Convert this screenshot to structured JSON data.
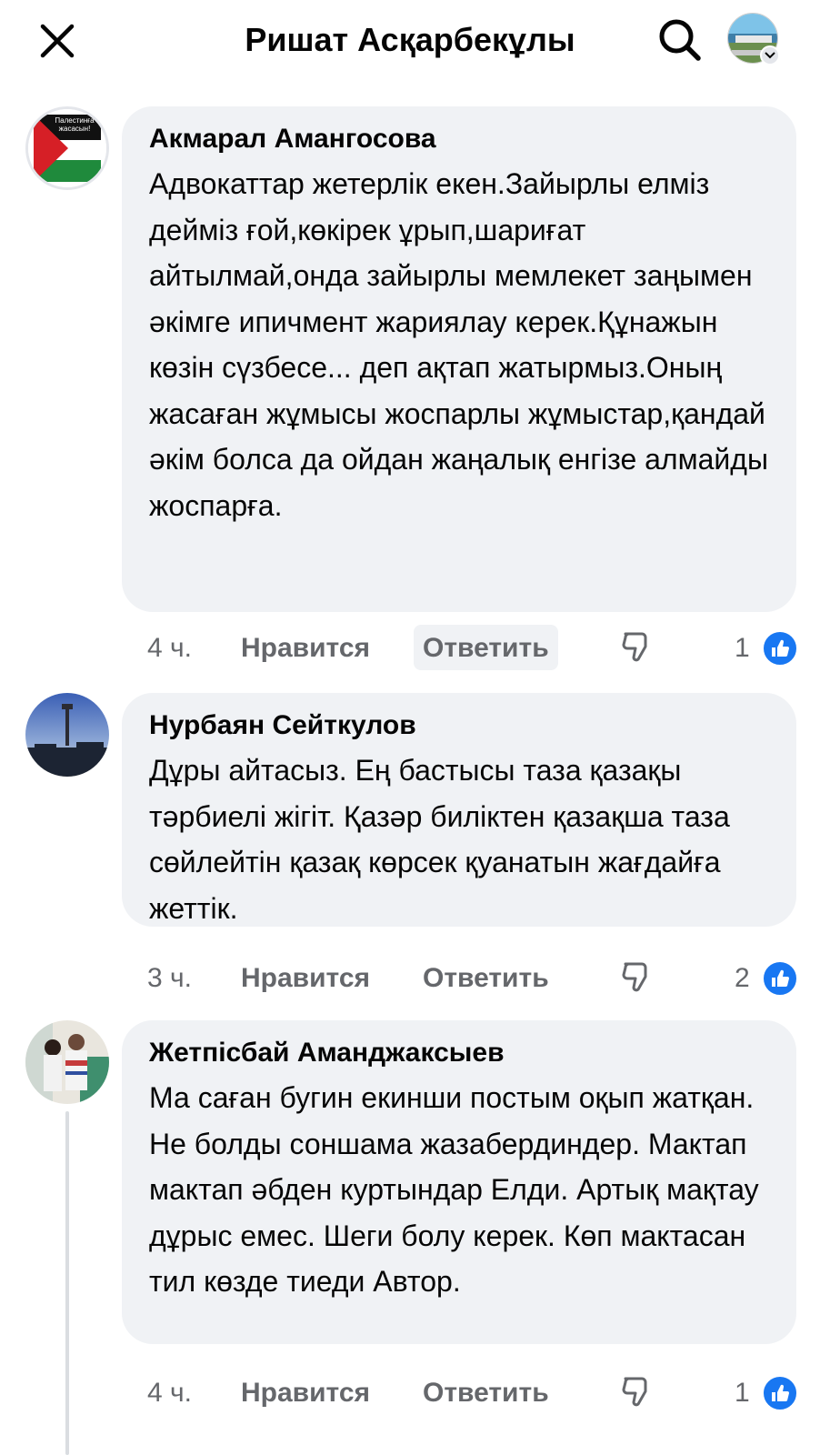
{
  "header": {
    "title": "Ришат Асқарбекұлы",
    "close_icon": "close-icon",
    "search_icon": "search-icon"
  },
  "comments": [
    {
      "author": "Акмарал Амангосова",
      "avatar_text": "Палестинға жасасын!",
      "text": "Адвокаттар жетерлік екен.Зайырлы елміз дейміз ғой,көкірек ұрып,шариғат айтылмай,онда зайырлы мемлекет заңымен әкімге ипичмент жариялау керек.Құнажын көзін сүзбесе... деп ақтап жатырмыз.Оның жасаған жұмысы жоспарлы жұмыстар,қандай әкім болса да ойдан жаңалық енгізе алмайды жоспарға.",
      "time": "4 ч.",
      "like_label": "Нравится",
      "reply_label": "Ответить",
      "reactions": "1"
    },
    {
      "author": "Нурбаян Сейткулов",
      "text": "Дұры айтасыз. Ең бастысы таза қазақы тәрбиелі жігіт. Қазәр биліктен қазақша таза сөйлейтін қазақ көрсек қуанатын жағдайға жеттік.",
      "time": "3 ч.",
      "like_label": "Нравится",
      "reply_label": "Ответить",
      "reactions": "2"
    },
    {
      "author": "Жетпісбай Аманджаксыев",
      "text": "Ма саған бугин екинши постым оқып жатқан. Не болды соншама жазабердиндер. Мактап мактап әбден куртындар Елди. Артық мақтау дұрыс емес. Шеги болу керек. Көп мактасан тил көзде тиеди Автор.",
      "time": "4 ч.",
      "like_label": "Нравится",
      "reply_label": "Ответить",
      "reactions": "1"
    }
  ],
  "colors": {
    "bubble": "#f0f2f5",
    "secondary_text": "#65676b",
    "like_blue": "#1877f2"
  }
}
